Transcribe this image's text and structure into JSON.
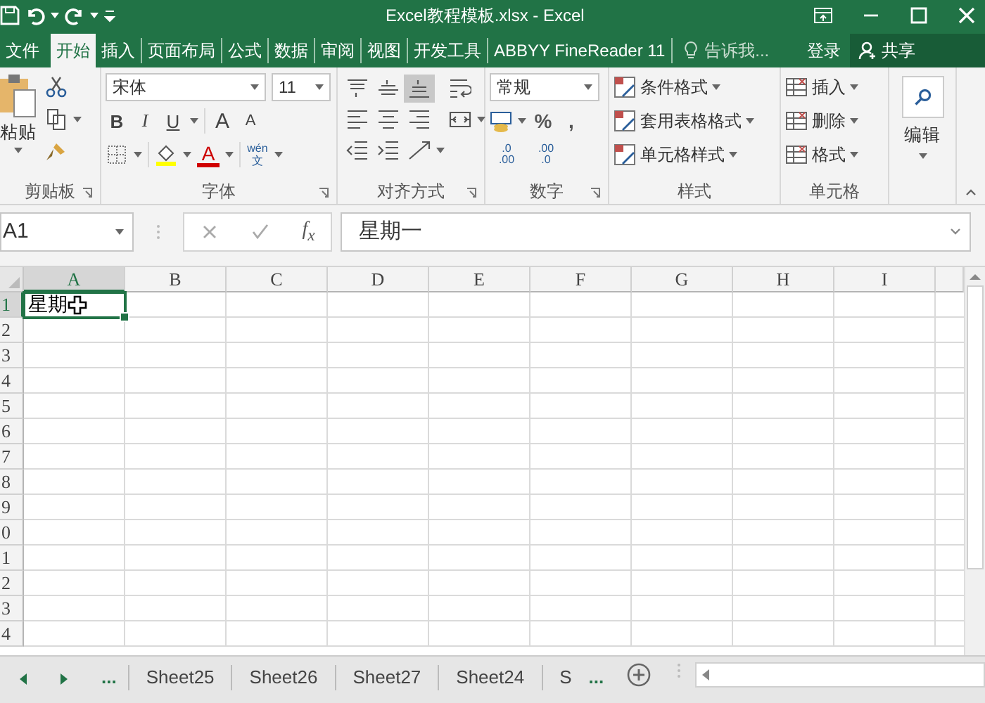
{
  "window": {
    "title": "Excel教程模板.xlsx - Excel"
  },
  "ribbon_tabs": [
    {
      "label": "文件",
      "selected": false
    },
    {
      "label": "开始",
      "selected": true
    },
    {
      "label": "插入",
      "selected": false
    },
    {
      "label": "页面布局",
      "selected": false
    },
    {
      "label": "公式",
      "selected": false
    },
    {
      "label": "数据",
      "selected": false
    },
    {
      "label": "审阅",
      "selected": false
    },
    {
      "label": "视图",
      "selected": false
    },
    {
      "label": "开发工具",
      "selected": false
    },
    {
      "label": "ABBYY FineReader 11",
      "selected": false
    }
  ],
  "tell_me": {
    "placeholder": "告诉我..."
  },
  "sign_in": "登录",
  "share": "共享",
  "clipboard": {
    "paste": "粘贴",
    "label": "剪贴板"
  },
  "font": {
    "name": "宋体",
    "size": "11",
    "bold": "B",
    "italic": "I",
    "underline": "U",
    "grow": "A",
    "shrink": "A",
    "font_color": "A",
    "phonetic_top": "wén",
    "phonetic_bottom": "文",
    "label": "字体"
  },
  "alignment": {
    "buttons": [
      {
        "kind": "top",
        "selected": false
      },
      {
        "kind": "middle",
        "selected": false
      },
      {
        "kind": "bottom",
        "selected": true
      },
      {
        "kind": "wrap",
        "selected": false
      },
      {
        "kind": "left",
        "selected": false
      },
      {
        "kind": "center",
        "selected": false
      },
      {
        "kind": "right",
        "selected": false
      },
      {
        "kind": "merge",
        "selected": false
      },
      {
        "kind": "outdent",
        "selected": false
      },
      {
        "kind": "indent",
        "selected": false
      },
      {
        "kind": "orientation",
        "selected": false
      }
    ],
    "label": "对齐方式"
  },
  "number": {
    "format": "常规",
    "percent": "%",
    "comma": ",",
    "increase_decimal": {
      "top": ".0",
      "bottom": ".00"
    },
    "decrease_decimal": {
      "top": ".00",
      "bottom": ".0"
    },
    "label": "数字"
  },
  "styles": {
    "items": [
      "条件格式",
      "套用表格格式",
      "单元格样式"
    ],
    "label": "样式"
  },
  "cells": {
    "items": [
      "插入",
      "删除",
      "格式"
    ],
    "label": "单元格"
  },
  "editing": {
    "label": "编辑"
  },
  "formula_bar": {
    "name_box": "A1",
    "fx": "f$_{x}$",
    "value": "星期一"
  },
  "sheet": {
    "columns": [
      {
        "label": "A",
        "selected": true
      },
      {
        "label": "B",
        "selected": false
      },
      {
        "label": "C",
        "selected": false
      },
      {
        "label": "D",
        "selected": false
      },
      {
        "label": "E",
        "selected": false
      },
      {
        "label": "F",
        "selected": false
      },
      {
        "label": "G",
        "selected": false
      },
      {
        "label": "H",
        "selected": false
      },
      {
        "label": "I",
        "selected": false
      }
    ],
    "rows": [
      {
        "label": "1",
        "selected": true
      },
      {
        "label": "2",
        "selected": false
      },
      {
        "label": "3",
        "selected": false
      },
      {
        "label": "4",
        "selected": false
      },
      {
        "label": "5",
        "selected": false
      },
      {
        "label": "6",
        "selected": false
      },
      {
        "label": "7",
        "selected": false
      },
      {
        "label": "8",
        "selected": false
      },
      {
        "label": "9",
        "selected": false
      },
      {
        "label": "0",
        "selected": false
      },
      {
        "label": "1",
        "selected": false
      },
      {
        "label": "2",
        "selected": false
      },
      {
        "label": "3",
        "selected": false
      },
      {
        "label": "4",
        "selected": false
      }
    ],
    "active_cell": {
      "text": "星期"
    }
  },
  "sheet_tabs": {
    "more_left": "...",
    "tabs": [
      {
        "label": "Sheet25",
        "selected": false
      },
      {
        "label": "Sheet26",
        "selected": false
      },
      {
        "label": "Sheet27",
        "selected": false
      },
      {
        "label": "Sheet24",
        "selected": false
      },
      {
        "label": "S",
        "selected": false
      }
    ],
    "more_right": "..."
  }
}
